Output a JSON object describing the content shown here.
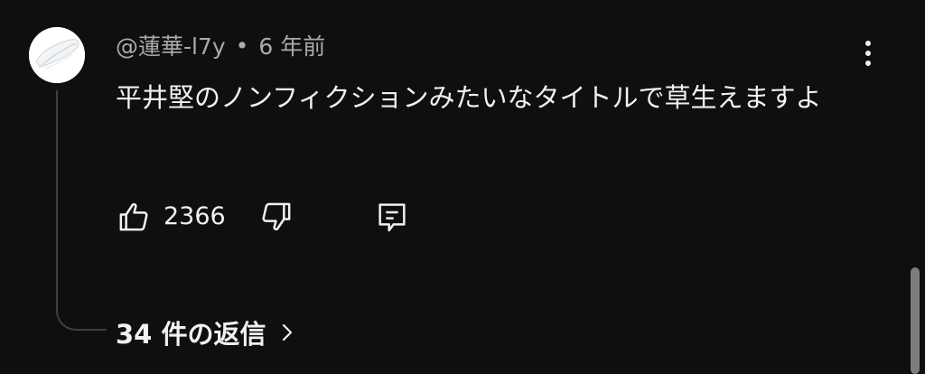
{
  "comment": {
    "author": "@蓮華-l7y",
    "separator": "•",
    "timestamp": "6 年前",
    "text": "平井堅のノンフィクションみたいなタイトルで草生えますよ",
    "like_count": "2366",
    "replies_label": "34 件の返信"
  },
  "icons": {
    "avatar": "avatar-image",
    "more": "more-vert-icon",
    "like": "thumb-up-icon",
    "dislike": "thumb-down-icon",
    "reply": "reply-comment-icon",
    "replies_chevron": "chevron-right-icon"
  },
  "colors": {
    "background": "#0f0f0f",
    "text_primary": "#f1f1f1",
    "text_secondary": "#aaaaaa",
    "thread_line": "#3f3f3f"
  }
}
